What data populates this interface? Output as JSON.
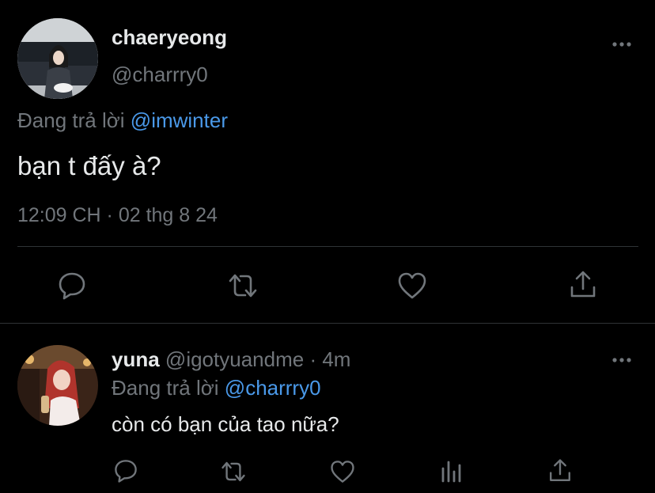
{
  "main_tweet": {
    "display_name": "chaeryeong",
    "handle": "@charrry0",
    "reply_prefix": "Đang trả lời",
    "reply_to": "@imwinter",
    "text": "bạn t đấy à?",
    "timestamp": "12:09 CH · 02 thg 8 24",
    "avatar_icon": "profile-photo-woman-sitting",
    "more_icon": "more-horizontal-icon"
  },
  "reply_tweet": {
    "display_name": "yuna",
    "handle": "@igotyuandme",
    "separator": "·",
    "time_ago": "4m",
    "reply_prefix": "Đang trả lời",
    "reply_to": "@charrry0",
    "text": "còn có bạn của tao nữa?",
    "avatar_icon": "profile-photo-woman-red-hair",
    "more_icon": "more-horizontal-icon"
  },
  "actions_main": [
    "reply-icon",
    "retweet-icon",
    "like-icon",
    "share-icon"
  ],
  "actions_reply": [
    "reply-icon",
    "retweet-icon",
    "like-icon",
    "analytics-icon",
    "share-icon"
  ],
  "colors": {
    "background": "#000000",
    "text": "#e7e9ea",
    "muted": "#71767b",
    "link": "#4a99e9",
    "divider": "#2f3336"
  }
}
